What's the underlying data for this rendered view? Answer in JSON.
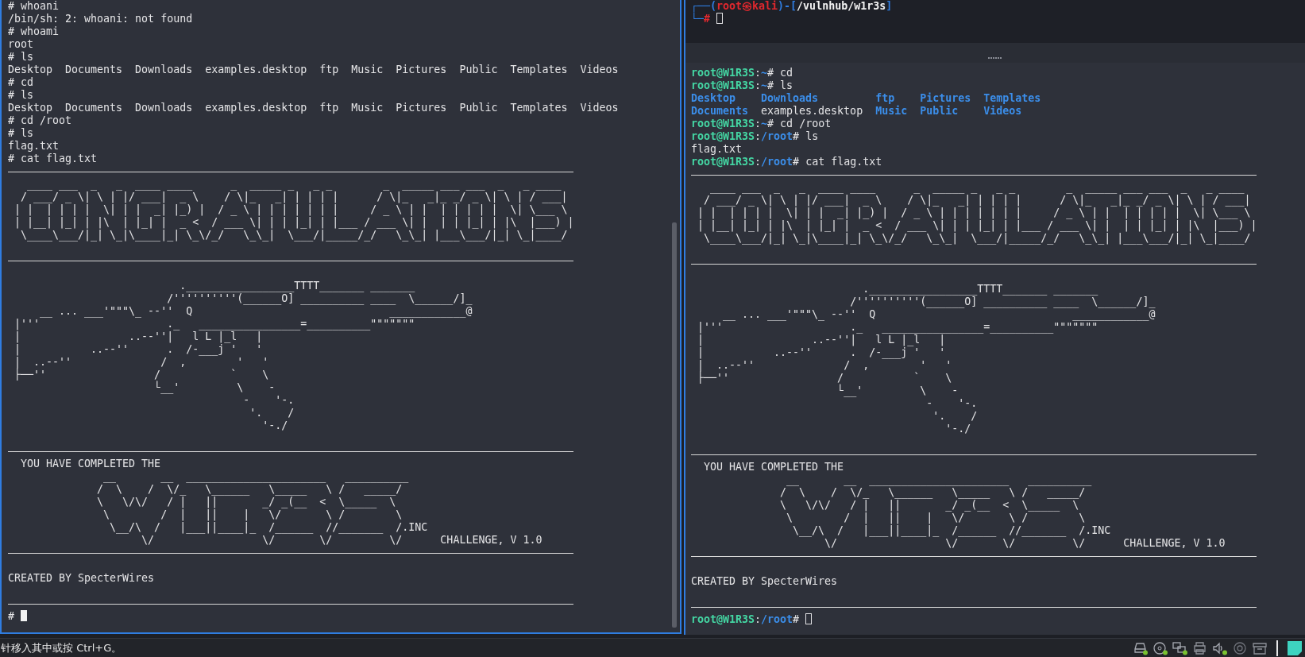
{
  "left_terminal": {
    "focused": true,
    "lines": [
      {
        "kind": "text",
        "text": "# whoani"
      },
      {
        "kind": "text",
        "text": "/bin/sh: 2: whoani: not found"
      },
      {
        "kind": "text",
        "text": "# whoami"
      },
      {
        "kind": "text",
        "text": "root"
      },
      {
        "kind": "text",
        "text": "# ls"
      },
      {
        "kind": "text",
        "text": "Desktop  Documents  Downloads  examples.desktop  ftp  Music  Pictures  Public  Templates  Videos"
      },
      {
        "kind": "text",
        "text": "# cd"
      },
      {
        "kind": "text",
        "text": "# ls"
      },
      {
        "kind": "text",
        "text": "Desktop  Documents  Downloads  examples.desktop  ftp  Music  Pictures  Public  Templates  Videos"
      },
      {
        "kind": "text",
        "text": "# cd /root"
      },
      {
        "kind": "text",
        "text": "# ls"
      },
      {
        "kind": "text",
        "text": "flag.txt"
      },
      {
        "kind": "text",
        "text": "# cat flag.txt"
      },
      {
        "kind": "rule"
      },
      {
        "kind": "art",
        "lines": [
          "   ____ ___  _   _  ____ ____      _  _____ _   _ _        _  _____ ___ ___  _   _ ____",
          "  / ___/ _ \\| \\ | |/ ___|  _ \\    / \\|_   _| | | | |      / \\|_   _|_ _/ _ \\| \\ | / ___|",
          " | |  | | | |  \\| | |  _| |_) |  / _ \\ | | | | | | |     / _ \\ | |  | | | | |  \\| \\___ \\",
          " | |__| |_| | |\\  | |_| |  _ <  / ___ \\| | | |_| | |___ / ___ \\| |  | | |_| | |\\  |___) |",
          "  \\____\\___/|_| \\_|\\____|_| \\_\\/_/   \\_\\_|  \\___/|_____/_/   \\_\\_| |___\\___/|_| \\_|____/"
        ]
      },
      {
        "kind": "blank"
      },
      {
        "kind": "rule"
      },
      {
        "kind": "blank"
      },
      {
        "kind": "art",
        "lines": [
          "                           ._________________TTTT_______ _______",
          "                         /''''''''''(______O] __________ ____  \\______/]_",
          "     __ ... ___'\"\"\"\\_ --''  Q                               ____________@",
          " |'''                    ._   ________________=__________\"\"\"\"\"\"\"",
          " |                 ..--''|   l L |_l   |",
          " |           ..--''      .  /-___j '   '",
          " |  ..--''              /  ,        '   '",
          " ├──''                 /           `    \\",
          "                       └__'         \\    -",
          "                                     -    '-.",
          "                                      '.    /",
          "                                        '-./"
        ]
      },
      {
        "kind": "blank"
      },
      {
        "kind": "rule"
      },
      {
        "kind": "text",
        "text": "  YOU HAVE COMPLETED THE"
      },
      {
        "kind": "art",
        "lines": [
          "               __       __  ______________________   __________",
          "              /  \\    /  \\/_   \\______   \\_____   \\ /   _____/",
          "              \\   \\/\\/   / |   ||       _/ _(__  <  \\_____  \\",
          "               \\        /  |   ||    |   \\/       \\ /        \\",
          "                \\__/\\  /   |___||____|_  /______  //_______  /.INC",
          "                     \\/                 \\/       \\/         \\/      CHALLENGE, V 1.0"
        ]
      },
      {
        "kind": "rule"
      },
      {
        "kind": "blank"
      },
      {
        "kind": "text",
        "text": "CREATED BY SpecterWires"
      },
      {
        "kind": "blank"
      },
      {
        "kind": "rule"
      },
      {
        "kind": "text",
        "text": "#",
        "cursor": true
      }
    ]
  },
  "kali_prompt": {
    "lines": [
      [
        {
          "text": "┌──(",
          "color": "#2f7de1"
        },
        {
          "text": "root㉿kali",
          "color": "#e0282e"
        },
        {
          "text": ")-[",
          "color": "#2f7de1"
        },
        {
          "text": "/vulnhub/w1r3s",
          "color": "#f2f2f2"
        },
        {
          "text": "]",
          "color": "#2f7de1"
        }
      ],
      [
        {
          "text": "└─",
          "color": "#2f7de1"
        },
        {
          "text": "#",
          "color": "#e0282e"
        }
      ]
    ],
    "cursor": true
  },
  "right_terminal": {
    "focused": false,
    "lines": [
      {
        "kind": "prompt",
        "user": "root@W1R3S",
        "sep": ":",
        "path": "~",
        "symbol": "#",
        "command": "cd"
      },
      {
        "kind": "prompt",
        "user": "root@W1R3S",
        "sep": ":",
        "path": "~",
        "symbol": "#",
        "command": "ls"
      },
      {
        "kind": "ls",
        "items": [
          {
            "name": "Desktop",
            "directory": true
          },
          {
            "name": "Downloads",
            "directory": true
          },
          {
            "name": "ftp",
            "directory": true
          },
          {
            "name": "Pictures",
            "directory": true
          },
          {
            "name": "Templates",
            "directory": true
          },
          {
            "name": "Documents",
            "directory": true
          },
          {
            "name": "examples.desktop",
            "directory": false
          },
          {
            "name": "Music",
            "directory": true
          },
          {
            "name": "Public",
            "directory": true
          },
          {
            "name": "Videos",
            "directory": true
          }
        ]
      },
      {
        "kind": "prompt",
        "user": "root@W1R3S",
        "sep": ":",
        "path": "~",
        "symbol": "#",
        "command": "cd /root"
      },
      {
        "kind": "prompt",
        "user": "root@W1R3S",
        "sep": ":",
        "path": "/root",
        "symbol": "#",
        "command": "ls"
      },
      {
        "kind": "text",
        "text": "flag.txt"
      },
      {
        "kind": "prompt",
        "user": "root@W1R3S",
        "sep": ":",
        "path": "/root",
        "symbol": "#",
        "command": "cat flag.txt"
      },
      {
        "kind": "rule"
      },
      {
        "kind": "art",
        "lines": [
          "   ____ ___  _   _  ____ ____      _  _____ _   _ _        _  _____ ___ ___  _   _ ____",
          "  / ___/ _ \\| \\ | |/ ___|  _ \\    / \\|_   _| | | | |      / \\|_   _|_ _/ _ \\| \\ | / ___|",
          " | |  | | | |  \\| | |  _| |_) |  / _ \\ | | | | | | |     / _ \\ | |  | | | | |  \\| \\___ \\",
          " | |__| |_| | |\\  | |_| |  _ <  / ___ \\| | | |_| | |___ / ___ \\| |  | | |_| | |\\  |___) |",
          "  \\____\\___/|_| \\_|\\____|_| \\_\\/_/   \\_\\_|  \\___/|_____/_/   \\_\\_| |___\\___/|_| \\_|____/"
        ]
      },
      {
        "kind": "blank"
      },
      {
        "kind": "rule"
      },
      {
        "kind": "blank"
      },
      {
        "kind": "art",
        "lines": [
          "                           ._________________TTTT_______ _______",
          "                         /''''''''''(______O] __________ ____  \\______/]_",
          "     __ ... ___'\"\"\"\\_ --''  Q                               ____________@",
          " |'''                    ._   ________________=__________\"\"\"\"\"\"\"",
          " |                 ..--''|   l L |_l   |",
          " |           ..--''      .  /-___j '   '",
          " |  ..--''              /  ,        '   '",
          " ├──''                 /           `    \\",
          "                       └__'         \\    -",
          "                                     -    '-.",
          "                                      '.    /",
          "                                        '-./"
        ]
      },
      {
        "kind": "blank"
      },
      {
        "kind": "rule"
      },
      {
        "kind": "text",
        "text": "  YOU HAVE COMPLETED THE"
      },
      {
        "kind": "art",
        "lines": [
          "               __       __  ______________________   __________",
          "              /  \\    /  \\/_   \\______   \\_____   \\ /   _____/",
          "              \\   \\/\\/   / |   ||       _/ _(__  <  \\_____  \\",
          "               \\        /  |   ||    |   \\/       \\ /        \\",
          "                \\__/\\  /   |___||____|_  /______  //_______  /.INC",
          "                     \\/                 \\/       \\/         \\/      CHALLENGE, V 1.0"
        ]
      },
      {
        "kind": "rule"
      },
      {
        "kind": "blank"
      },
      {
        "kind": "text",
        "text": "CREATED BY SpecterWires"
      },
      {
        "kind": "blank"
      },
      {
        "kind": "rule"
      },
      {
        "kind": "prompt",
        "user": "root@W1R3S",
        "sep": ":",
        "path": "/root",
        "symbol": "#",
        "cursor": true
      }
    ]
  },
  "status_bar": {
    "text": "针移入其中或按 Ctrl+G。"
  }
}
